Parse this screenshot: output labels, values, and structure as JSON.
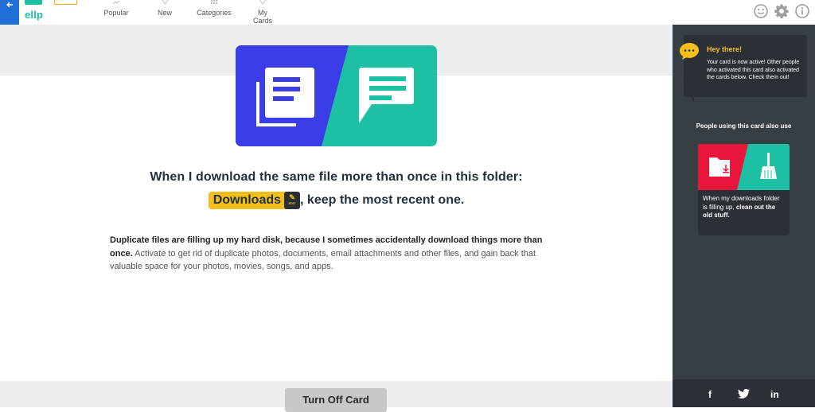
{
  "nav": {
    "logo_text": "ellp",
    "items": [
      {
        "label": "Popular",
        "icon": "trending-icon"
      },
      {
        "label": "New",
        "icon": "star-icon"
      },
      {
        "label": "Categories",
        "icon": "grid-icon"
      },
      {
        "label": "My Cards",
        "icon": "heart-icon"
      }
    ],
    "right_icons": [
      "smiley-icon",
      "gear-icon",
      "info-icon"
    ]
  },
  "colors": {
    "brand": "#1ec0a4",
    "hero_left": "#3a3de8",
    "hero_right": "#1ec0a4",
    "chip": "#f3bf1b",
    "panel": "#373e44",
    "mini_left": "#e8163a"
  },
  "card": {
    "headline": "When I download the same file more than once in this folder:",
    "folder_chip": "Downloads",
    "chip_edit_label": "EDIT",
    "line2_suffix": ", keep the most recent one.",
    "desc_bold": "Duplicate files are filling up my hard disk, because I sometimes accidentally download things more than once.",
    "desc_rest": " Activate to get rid of duplicate photos, documents, email attachments and other files, and gain back that valuable space for your photos, movies, songs, and apps.",
    "turn_off_label": "Turn Off Card"
  },
  "panel": {
    "bubble_title": "Hey there!",
    "bubble_text": "Your card is now active! Other people who activated this card also activated the cards below. Check them out!",
    "heading": "People using this card also use",
    "related_card": {
      "text_plain": "When my downloads folder is filling up,",
      "text_bold": "clean out the old stuff."
    },
    "social": [
      "f",
      "t",
      "in"
    ]
  }
}
